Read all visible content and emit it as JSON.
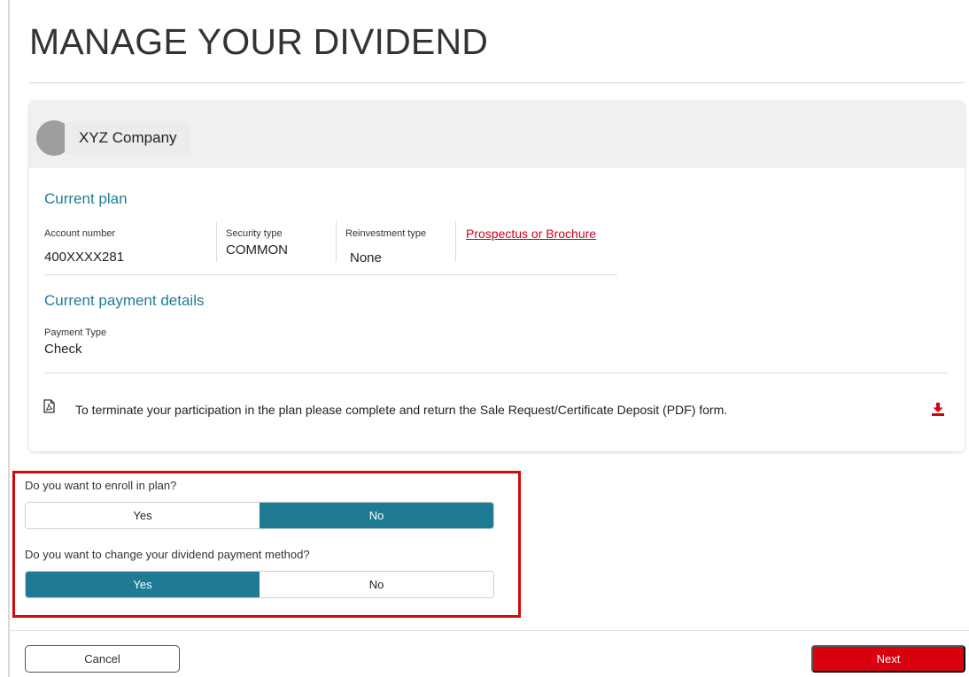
{
  "page": {
    "title": "MANAGE YOUR DIVIDEND"
  },
  "company": {
    "name": "XYZ Company"
  },
  "current_plan": {
    "heading": "Current plan",
    "account_number_label": "Account number",
    "account_number_value": "400XXXX281",
    "security_type_label": "Security type",
    "security_type_value": "COMMON",
    "reinvestment_type_label": "Reinvestment type",
    "reinvestment_type_value": "None",
    "prospectus_link": "Prospectus or Brochure"
  },
  "payment_details": {
    "heading": "Current payment details",
    "payment_type_label": "Payment Type",
    "payment_type_value": "Check"
  },
  "termination_notice": "To terminate your participation in the plan please complete and return the Sale Request/Certificate Deposit (PDF) form.",
  "questions": {
    "enroll": {
      "text": "Do you want to enroll in plan?",
      "yes": "Yes",
      "no": "No",
      "selected": "No"
    },
    "change_method": {
      "text": "Do you want to change your dividend payment method?",
      "yes": "Yes",
      "no": "No",
      "selected": "Yes"
    }
  },
  "buttons": {
    "cancel": "Cancel",
    "next": "Next"
  },
  "icons": {
    "file": "pdf-file-icon",
    "download": "download-icon"
  },
  "colors": {
    "accent": "#1f7a94",
    "brand_red": "#d9000f",
    "highlight_border": "#d00a0a",
    "link": "#d0021b"
  }
}
